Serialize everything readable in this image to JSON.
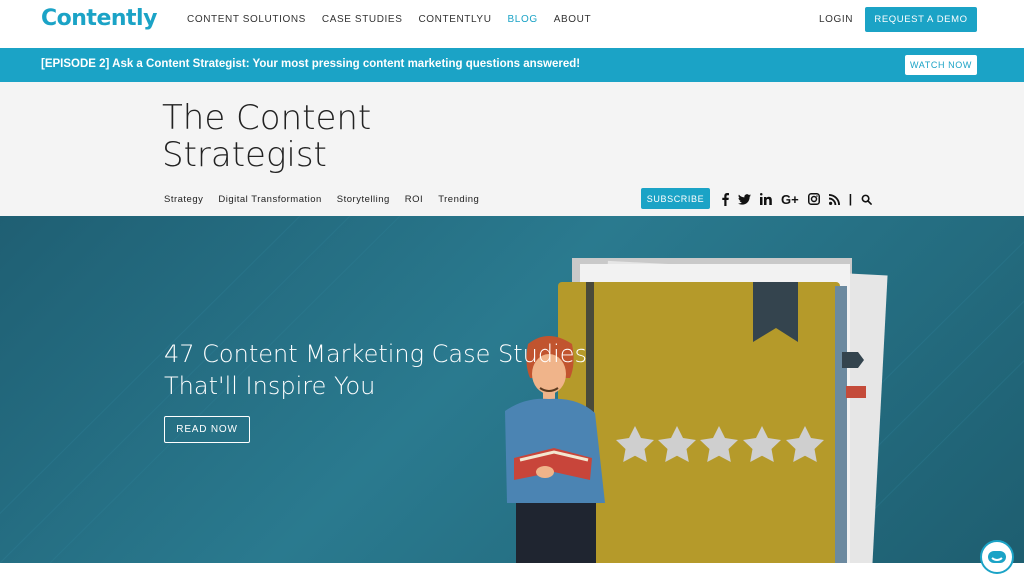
{
  "brand": {
    "logo_text": "Contently",
    "accent": "#1ba3c6"
  },
  "nav": {
    "items": [
      {
        "label": "CONTENT SOLUTIONS"
      },
      {
        "label": "CASE STUDIES"
      },
      {
        "label": "CONTENTLYU"
      },
      {
        "label": "BLOG"
      },
      {
        "label": "ABOUT"
      }
    ],
    "login": "LOGIN",
    "demo": "REQUEST A DEMO"
  },
  "announcement": {
    "text": "[EPISODE 2] Ask a Content Strategist: Your most pressing content marketing questions answered!",
    "button": "WATCH NOW"
  },
  "blog": {
    "title_line1": "The Content",
    "title_line2": "Strategist",
    "categories": [
      "Strategy",
      "Digital Transformation",
      "Storytelling",
      "ROI",
      "Trending"
    ],
    "subscribe": "SUBSCRIBE",
    "social": [
      "facebook-icon",
      "twitter-icon",
      "linkedin-icon",
      "google-plus-icon",
      "instagram-icon",
      "rss-icon",
      "search-icon"
    ]
  },
  "hero": {
    "title_line1": "47 Content Marketing Case Studies",
    "title_line2": "That'll Inspire You",
    "button": "READ NOW"
  }
}
